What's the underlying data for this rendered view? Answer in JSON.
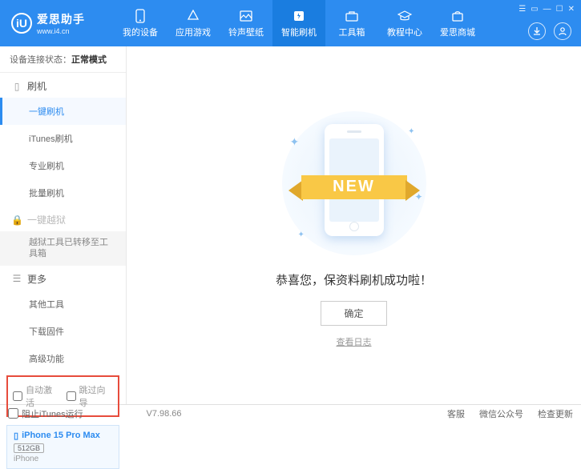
{
  "header": {
    "logo": {
      "icon_text": "iU",
      "title": "爱思助手",
      "subtitle": "www.i4.cn"
    },
    "nav": [
      {
        "label": "我的设备"
      },
      {
        "label": "应用游戏"
      },
      {
        "label": "铃声壁纸"
      },
      {
        "label": "智能刷机",
        "active": true
      },
      {
        "label": "工具箱"
      },
      {
        "label": "教程中心"
      },
      {
        "label": "爱思商城"
      }
    ]
  },
  "sidebar": {
    "status_label": "设备连接状态：",
    "status_value": "正常模式",
    "sections": {
      "flash": {
        "title": "刷机",
        "items": [
          "一键刷机",
          "iTunes刷机",
          "专业刷机",
          "批量刷机"
        ]
      },
      "jailbreak": {
        "title": "一键越狱",
        "note": "越狱工具已转移至工具箱"
      },
      "more": {
        "title": "更多",
        "items": [
          "其他工具",
          "下载固件",
          "高级功能"
        ]
      }
    },
    "checkboxes": {
      "auto_activate": "自动激活",
      "skip_guide": "跳过向导"
    },
    "device": {
      "name": "iPhone 15 Pro Max",
      "capacity": "512GB",
      "type": "iPhone"
    }
  },
  "main": {
    "ribbon": "NEW",
    "success": "恭喜您，保资料刷机成功啦！",
    "ok": "确定",
    "log": "查看日志"
  },
  "footer": {
    "block_itunes": "阻止iTunes运行",
    "version": "V7.98.66",
    "links": [
      "客服",
      "微信公众号",
      "检查更新"
    ]
  }
}
